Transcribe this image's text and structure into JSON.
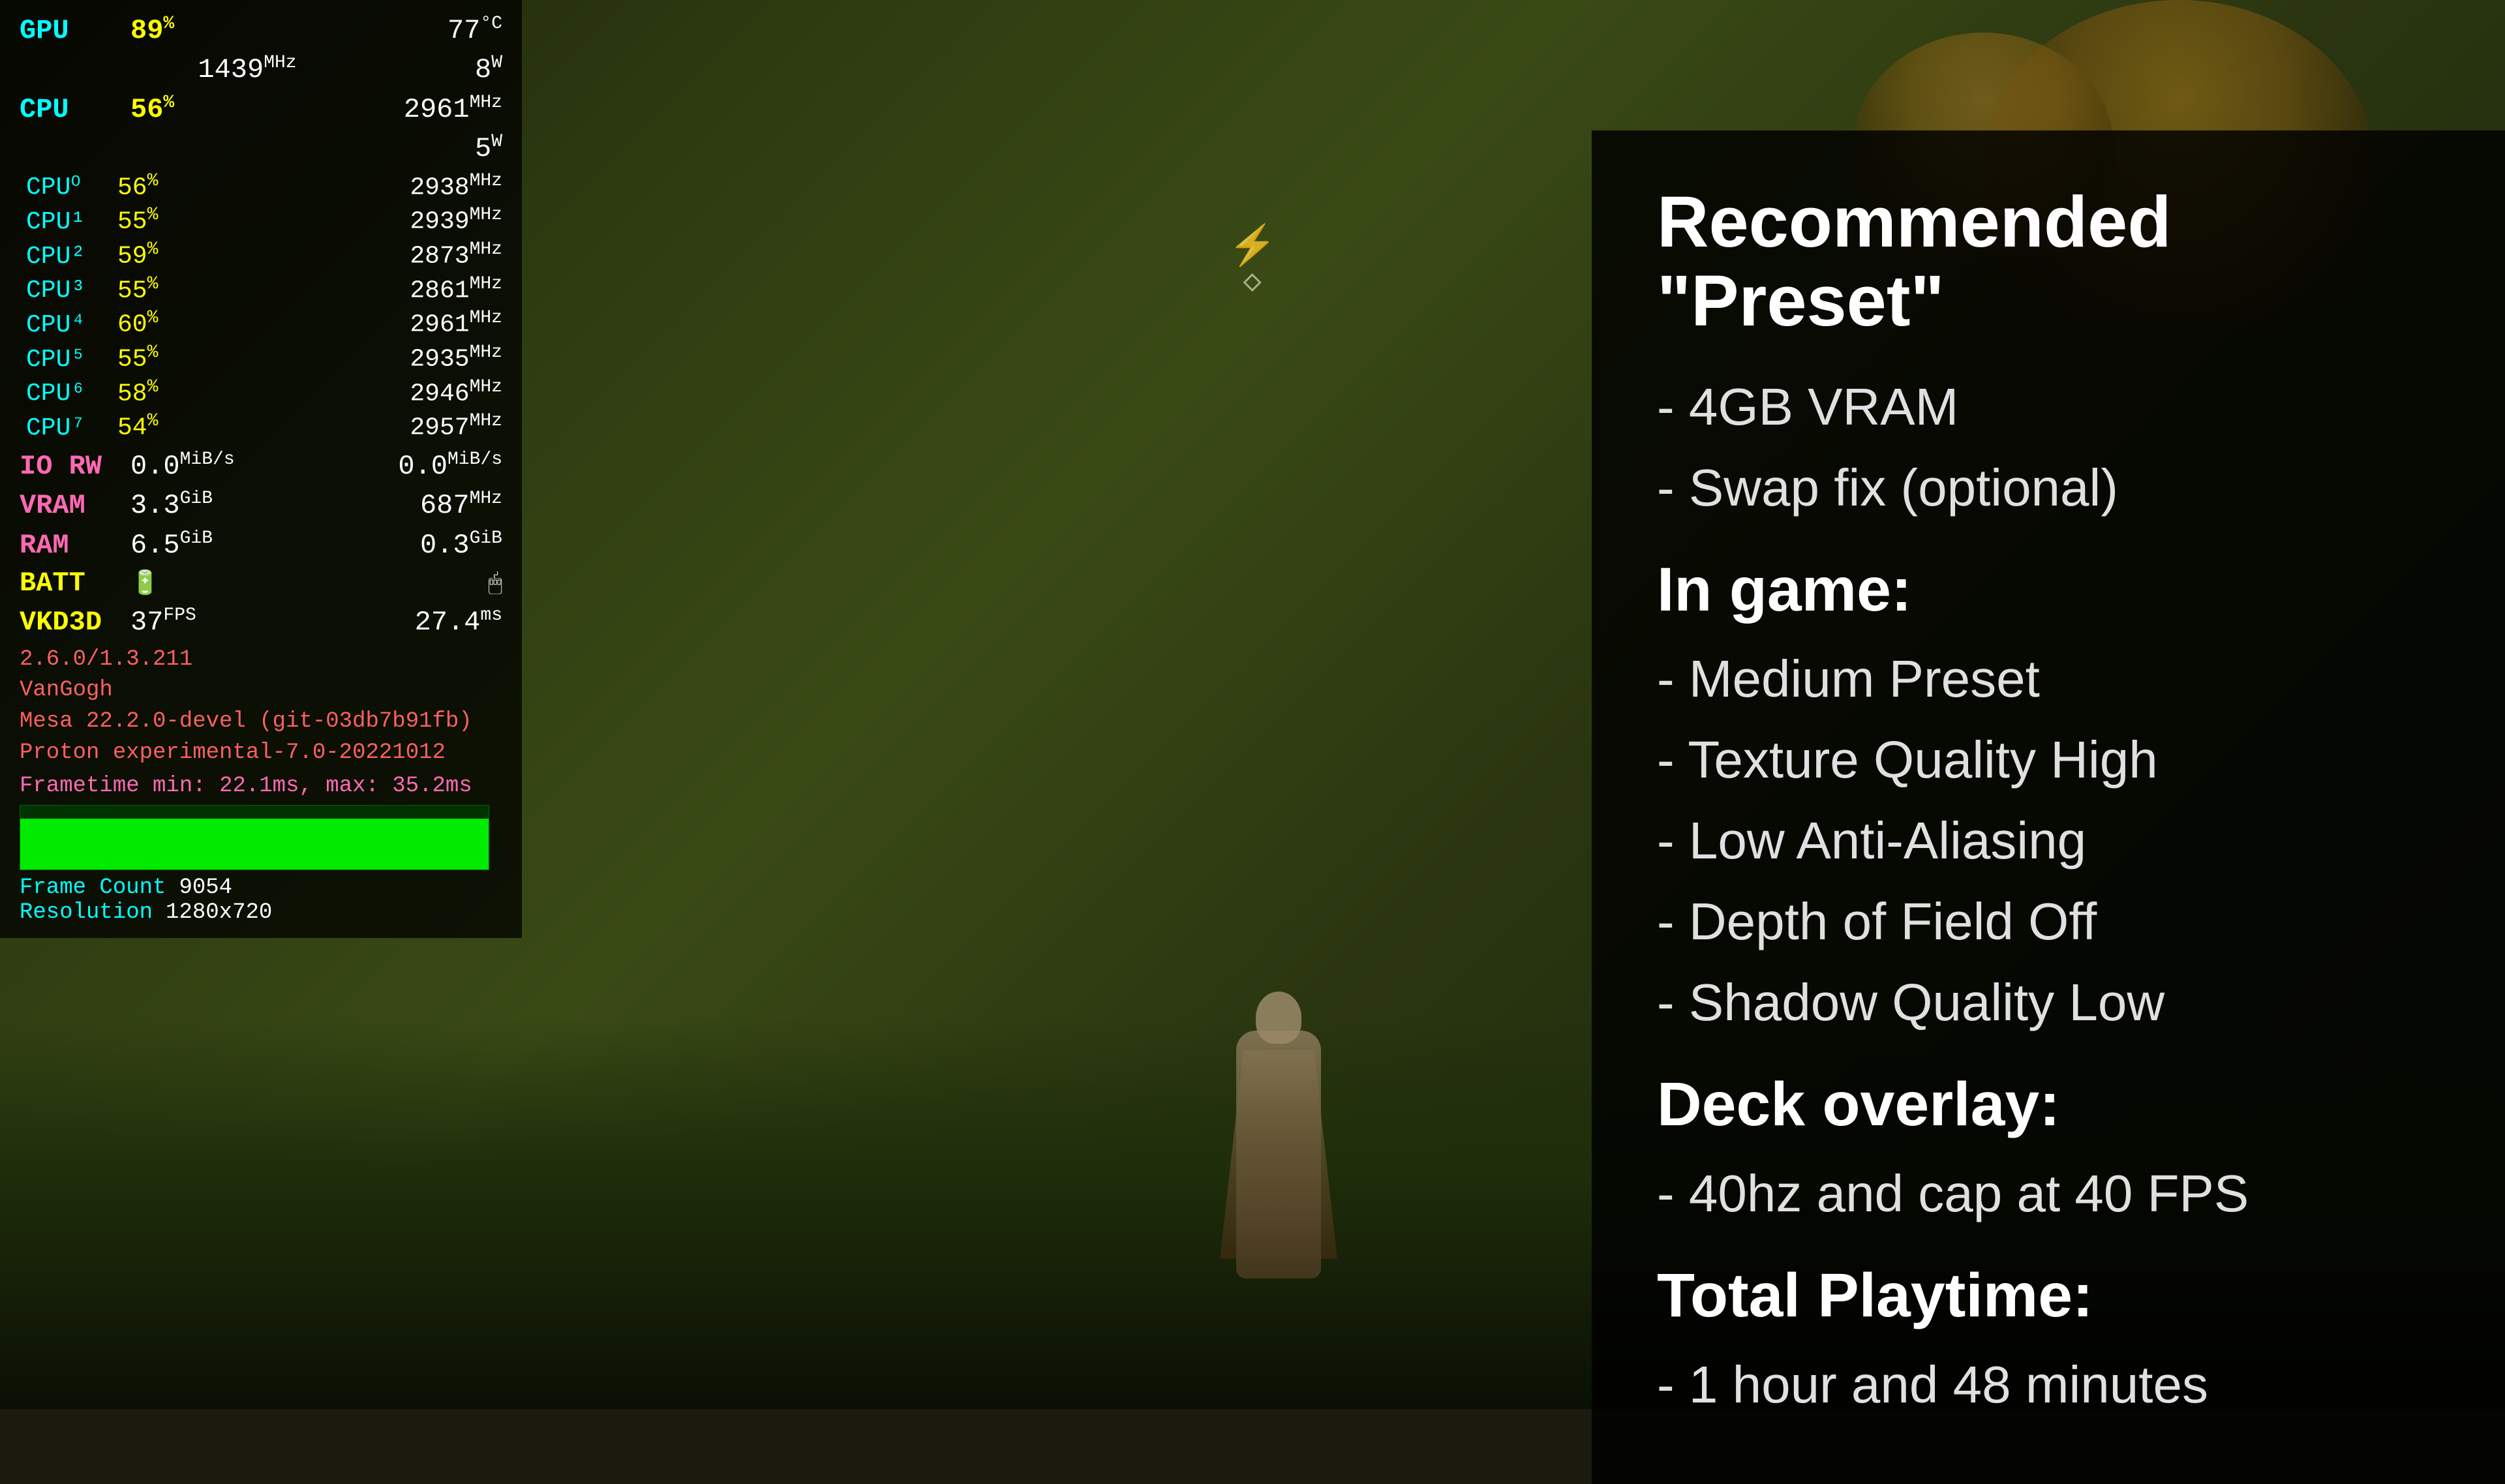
{
  "game": {
    "background_desc": "Dark fantasy forest environment"
  },
  "perf": {
    "gpu_label": "GPU",
    "gpu_usage": "89",
    "gpu_usage_unit": "%",
    "gpu_temp": "77",
    "gpu_temp_unit": "°C",
    "gpu_freq": "1439",
    "gpu_freq_unit": "MHz",
    "gpu_power": "8",
    "gpu_power_unit": "W",
    "cpu_label": "CPU",
    "cpu_usage": "56",
    "cpu_usage_unit": "%",
    "cpu_freq": "2961",
    "cpu_freq_unit": "MHz",
    "cpu_power": "5",
    "cpu_power_unit": "W",
    "cores": [
      {
        "label": "CPU⁰",
        "usage": "56",
        "freq": "2938"
      },
      {
        "label": "CPU¹",
        "usage": "55",
        "freq": "2939"
      },
      {
        "label": "CPU²",
        "usage": "59",
        "freq": "2873"
      },
      {
        "label": "CPU³",
        "usage": "55",
        "freq": "2861"
      },
      {
        "label": "CPU⁴",
        "usage": "60",
        "freq": "2961"
      },
      {
        "label": "CPU⁵",
        "usage": "55",
        "freq": "2935"
      },
      {
        "label": "CPU⁶",
        "usage": "58",
        "freq": "2946"
      },
      {
        "label": "CPU⁷",
        "usage": "54",
        "freq": "2957"
      }
    ],
    "io_label": "IO RW",
    "io_read": "0.0",
    "io_read_unit": "MiB/s",
    "io_write": "0.0",
    "io_write_unit": "MiB/s",
    "vram_label": "VRAM",
    "vram_used": "3.3",
    "vram_used_unit": "GiB",
    "vram_freq": "687",
    "vram_freq_unit": "MHz",
    "ram_label": "RAM",
    "ram_used": "6.5",
    "ram_used_unit": "GiB",
    "ram_other": "0.3",
    "ram_other_unit": "GiB",
    "batt_label": "BATT",
    "fps_label": "VKD3D",
    "fps_value": "37",
    "fps_unit": "FPS",
    "frametime_value": "27.4",
    "frametime_unit": "ms",
    "version": "2.6.0/1.3.211",
    "gpu_name": "VanGogh",
    "mesa": "Mesa 22.2.0-devel (git-03db7b91fb)",
    "proton": "Proton experimental-7.0-20221012",
    "frametime_label": "Frametime",
    "frametime_min": "min: 22.1ms, max: 35.2ms",
    "frame_count_label": "Frame Count",
    "frame_count": "9054",
    "resolution_label": "Resolution",
    "resolution": "1280x720"
  },
  "panel": {
    "title": "Recommended \"Preset\"",
    "vram_item": "- 4GB VRAM",
    "swap_item": "- Swap fix (optional)",
    "ingame_title": "In game:",
    "ingame_items": [
      "- Medium Preset",
      "- Texture Quality High",
      "- Low Anti-Aliasing",
      "- Depth of Field Off",
      "- Shadow Quality Low"
    ],
    "deck_title": "Deck overlay:",
    "deck_item": "- 40hz and cap at 40 FPS",
    "playtime_title": "Total Playtime:",
    "playtime_item": "- 1 hour and 48 minutes"
  }
}
